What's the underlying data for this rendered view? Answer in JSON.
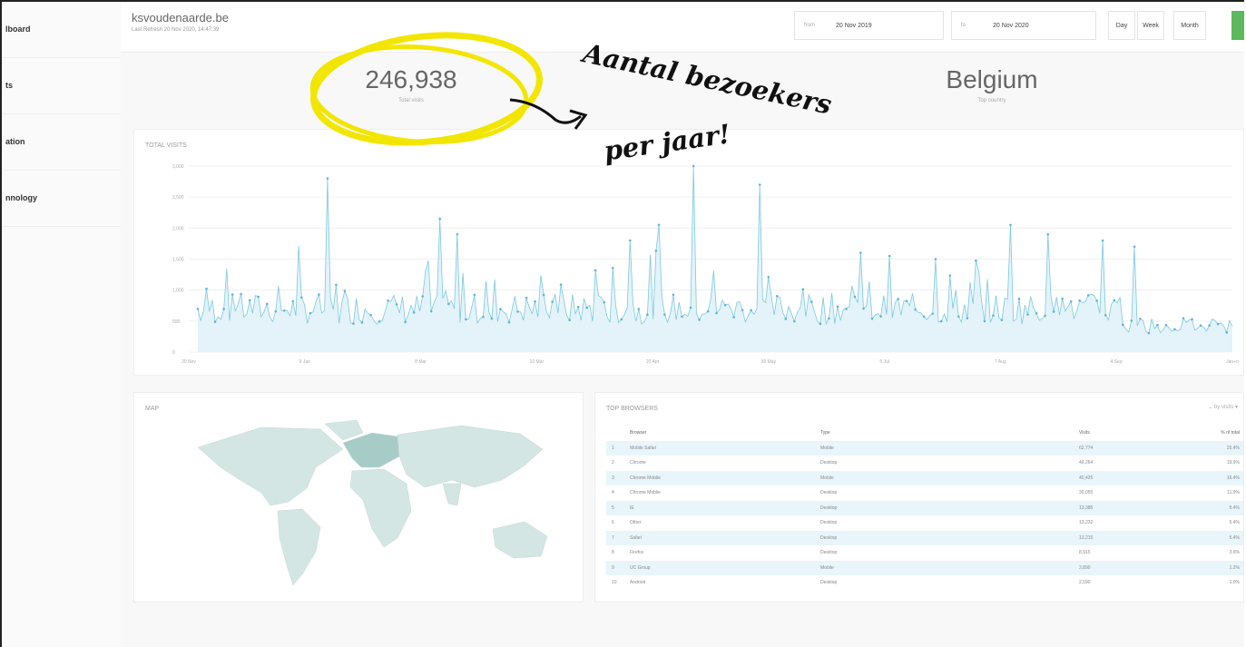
{
  "header": {
    "site_title": "ksvoudenaarde.be",
    "site_sub": "Last Refresh 20 Nov 2020, 14:47:39",
    "from_label": "from",
    "from_value": "20 Nov 2019",
    "to_label": "to",
    "to_value": "20 Nov 2020",
    "buttons": [
      "Day",
      "Week",
      "Month"
    ]
  },
  "sidebar": {
    "items": [
      "lboard",
      "ts",
      "ation",
      "nnology"
    ]
  },
  "stats": [
    {
      "value": "246,938",
      "label": "Total visits"
    },
    {
      "value": "Belgium",
      "label": "Top country"
    }
  ],
  "panels": {
    "visits_title": "TOTAL VISITS",
    "map_title": "MAP",
    "browsers_title": "TOP BROWSERS",
    "browsers_toggle": "⌄ by visits ▾"
  },
  "annotation": {
    "line1": "Aantal bezoekers",
    "line2": "per jaar!"
  },
  "chart_data": {
    "type": "area",
    "title": "TOTAL VISITS",
    "yticks": [
      "0",
      "500",
      "1,000",
      "1,500",
      "2,000",
      "2,500",
      "3,000"
    ],
    "xticks": [
      "20 Nov",
      "9 Jan",
      "8 Mar",
      "10 Mar",
      "20 Apr",
      "30 May",
      "5 Jul",
      "7 Aug",
      "4 Sep",
      "Jan+n"
    ],
    "ylim": [
      0,
      3000
    ]
  },
  "browsers": {
    "columns": [
      "Browser",
      "Type",
      "Visits",
      "% of total"
    ],
    "rows": [
      [
        "1",
        "Mobile Safari",
        "Mobile",
        "62,774",
        "25.4%"
      ],
      [
        "2",
        "Chrome",
        "Desktop",
        "49,264",
        "19.9%"
      ],
      [
        "3",
        "Chrome Mobile",
        "Mobile",
        "40,425",
        "16.4%"
      ],
      [
        "4",
        "Chrome Mobile",
        "Desktop",
        "30,055",
        "11.9%"
      ],
      [
        "5",
        "IE",
        "Desktop",
        "13,385",
        "5.4%"
      ],
      [
        "6",
        "Other",
        "Desktop",
        "13,232",
        "5.4%"
      ],
      [
        "7",
        "Safari",
        "Desktop",
        "13,215",
        "5.4%"
      ],
      [
        "8",
        "Firefox",
        "Desktop",
        "8,915",
        "3.6%"
      ],
      [
        "9",
        "UC Group",
        "Mobile",
        "2,890",
        "1.2%"
      ],
      [
        "10",
        "Android",
        "Desktop",
        "2,590",
        "1.0%"
      ]
    ]
  }
}
